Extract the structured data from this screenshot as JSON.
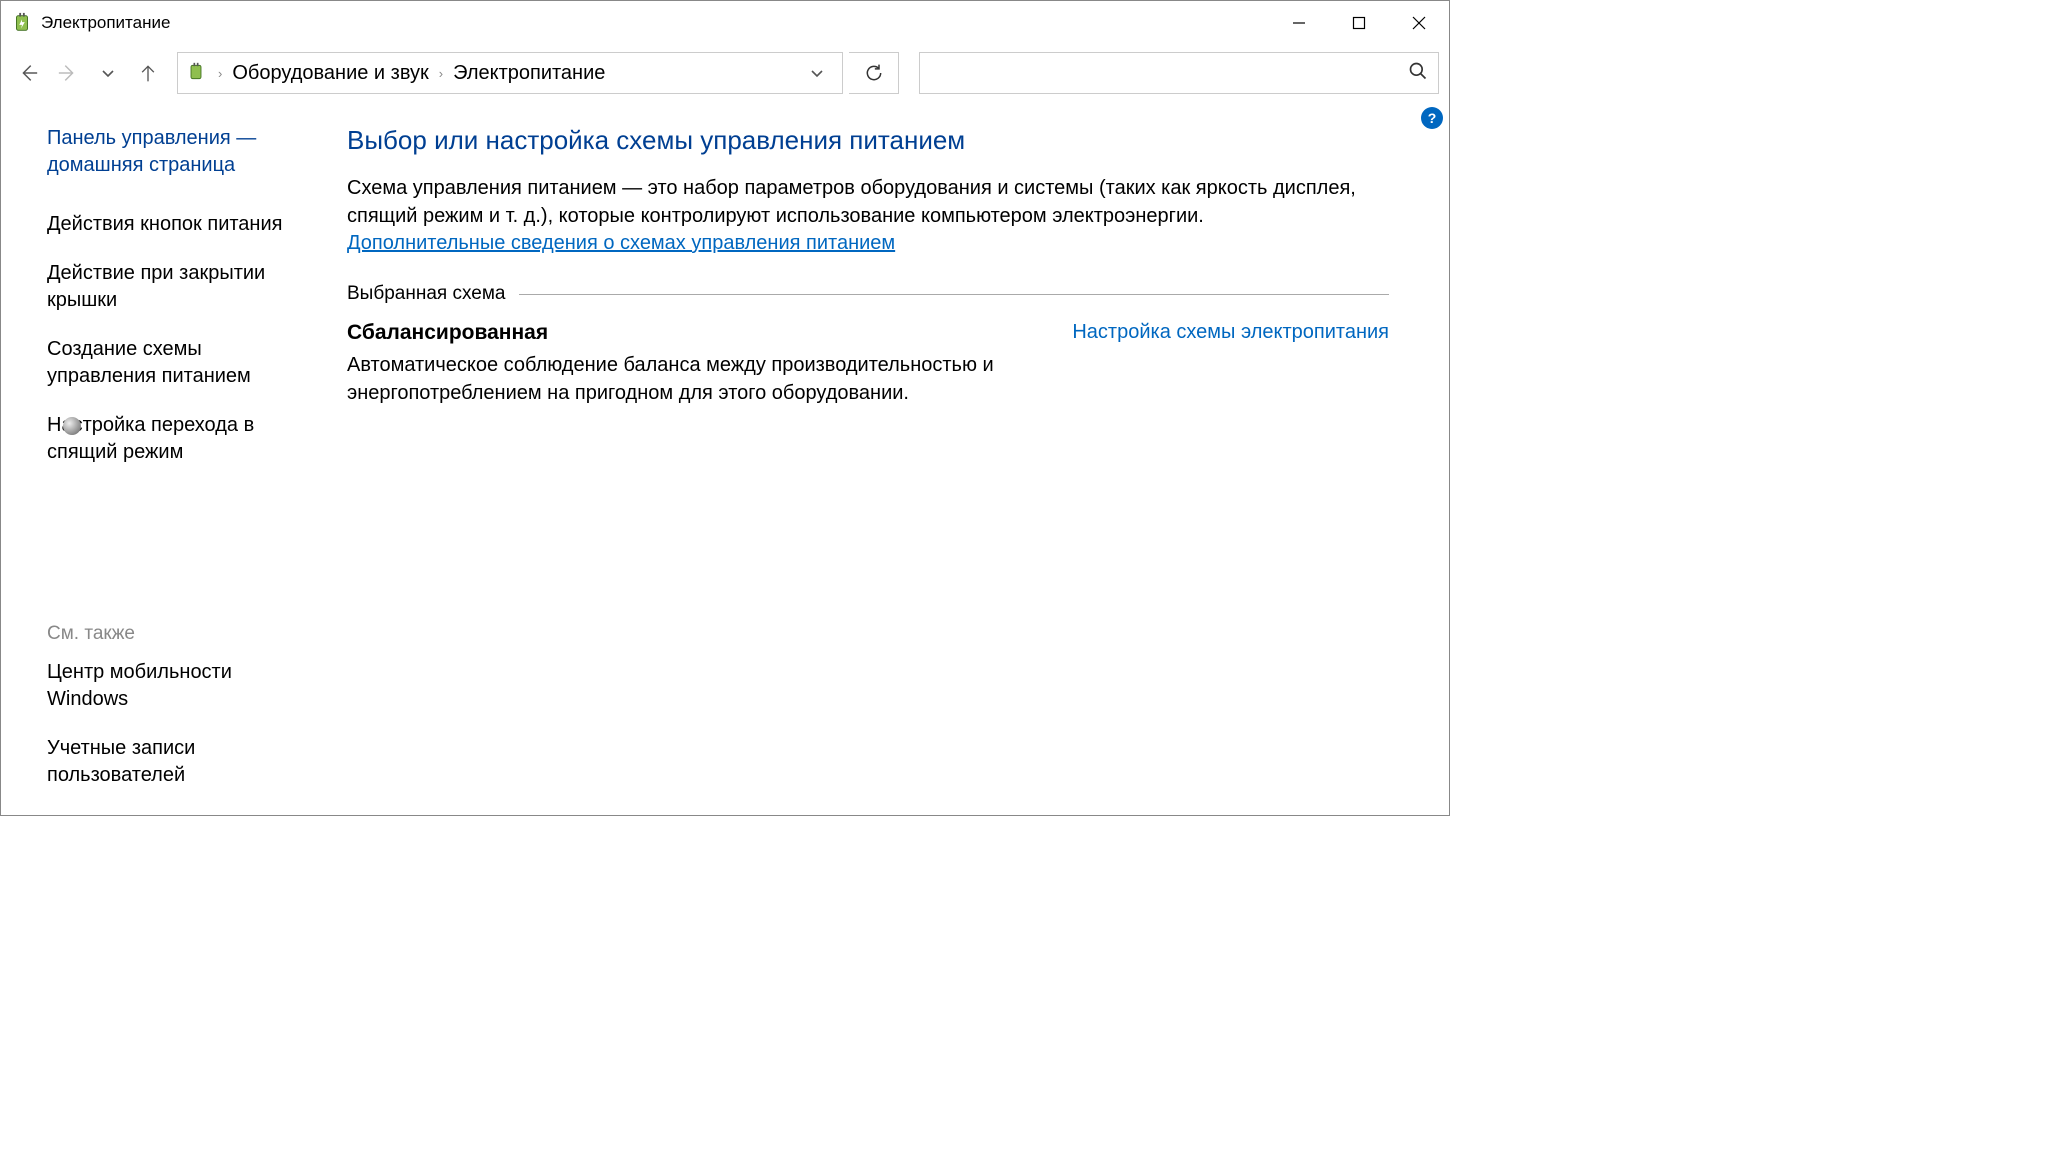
{
  "window": {
    "title": "Электропитание"
  },
  "breadcrumb": {
    "item1": "Оборудование и звук",
    "item2": "Электропитание"
  },
  "sidebar": {
    "home": "Панель управления — домашняя страница",
    "items": [
      "Действия кнопок питания",
      "Действие при закрытии крышки",
      "Создание схемы управления питанием",
      "Настройка перехода в спящий режим"
    ],
    "seeAlsoLabel": "См. также",
    "seeAlso": [
      "Центр мобильности Windows",
      "Учетные записи пользователей"
    ]
  },
  "main": {
    "title": "Выбор или настройка схемы управления питанием",
    "description": "Схема управления питанием — это набор параметров оборудования и системы (таких как яркость дисплея, спящий режим и т. д.), которые контролируют использование компьютером электроэнергии.",
    "moreInfo": "Дополнительные сведения о схемах управления питанием",
    "sectionLabel": "Выбранная схема",
    "planName": "Сбалансированная",
    "planSettingsLink": "Настройка схемы электропитания",
    "planDescription": "Автоматическое соблюдение баланса между производительностью и энергопотреблением на пригодном для этого оборудовании."
  },
  "search": {
    "placeholder": ""
  },
  "help": {
    "label": "?"
  }
}
